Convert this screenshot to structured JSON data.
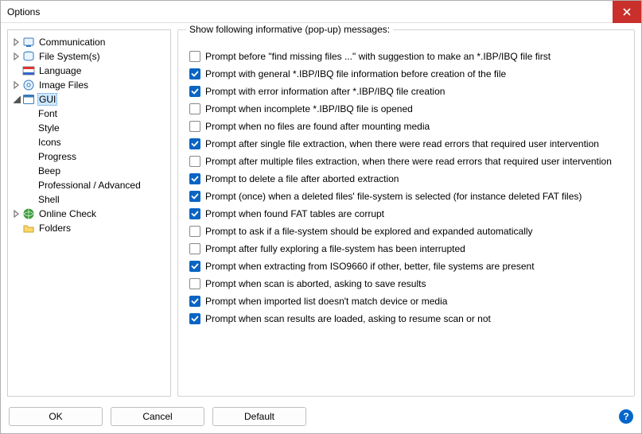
{
  "window": {
    "title": "Options"
  },
  "tree": [
    {
      "label": "Communication",
      "icon": "comm",
      "expandable": true,
      "expanded": false
    },
    {
      "label": "File System(s)",
      "icon": "fs",
      "expandable": true,
      "expanded": false
    },
    {
      "label": "Language",
      "icon": "lang",
      "expandable": false
    },
    {
      "label": "Image Files",
      "icon": "imgfiles",
      "expandable": true,
      "expanded": false
    },
    {
      "label": "GUI",
      "icon": "gui",
      "expandable": true,
      "expanded": true,
      "selected": true,
      "children": [
        {
          "label": "Font"
        },
        {
          "label": "Style"
        },
        {
          "label": "Icons"
        },
        {
          "label": "Progress"
        },
        {
          "label": "Beep"
        },
        {
          "label": "Professional / Advanced"
        },
        {
          "label": "Shell"
        }
      ]
    },
    {
      "label": "Online Check",
      "icon": "online",
      "expandable": true,
      "expanded": false
    },
    {
      "label": "Folders",
      "icon": "folders",
      "expandable": false
    }
  ],
  "group": {
    "legend": "Show following informative (pop-up) messages:",
    "items": [
      {
        "checked": false,
        "label": "Prompt before \"find missing files ...\" with suggestion to make an *.IBP/IBQ file first"
      },
      {
        "checked": true,
        "label": "Prompt with general *.IBP/IBQ file information before creation of the file"
      },
      {
        "checked": true,
        "label": "Prompt with error information after *.IBP/IBQ file creation"
      },
      {
        "checked": false,
        "label": "Prompt when incomplete *.IBP/IBQ file is opened"
      },
      {
        "checked": false,
        "label": "Prompt when no files are found after mounting media"
      },
      {
        "checked": true,
        "label": "Prompt after single file extraction, when there were read errors that required user intervention"
      },
      {
        "checked": false,
        "label": "Prompt after multiple files extraction, when there were read errors that required user intervention"
      },
      {
        "checked": true,
        "label": "Prompt to delete a file after aborted extraction"
      },
      {
        "checked": true,
        "label": "Prompt (once) when a deleted files' file-system is selected (for instance deleted FAT files)"
      },
      {
        "checked": true,
        "label": "Prompt when found FAT tables are corrupt"
      },
      {
        "checked": false,
        "label": "Prompt to ask if a file-system should be explored and expanded automatically"
      },
      {
        "checked": false,
        "label": "Prompt after fully exploring a file-system has been interrupted"
      },
      {
        "checked": true,
        "label": "Prompt when extracting from ISO9660 if other, better, file systems are present"
      },
      {
        "checked": false,
        "label": "Prompt when scan is aborted, asking to save results"
      },
      {
        "checked": true,
        "label": "Prompt when imported list doesn't match device or media"
      },
      {
        "checked": true,
        "label": "Prompt when scan results are loaded, asking to resume scan or not"
      }
    ]
  },
  "buttons": {
    "ok": "OK",
    "cancel": "Cancel",
    "default": "Default"
  }
}
